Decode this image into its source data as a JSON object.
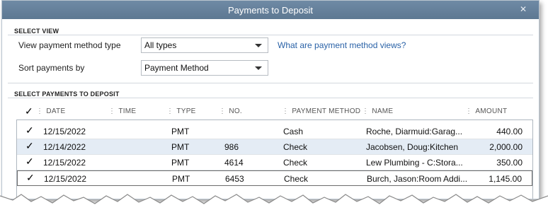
{
  "window": {
    "title": "Payments to Deposit",
    "close_glyph": "✕"
  },
  "select_view": {
    "header": "SELECT VIEW",
    "method_type_label": "View payment method type",
    "method_type_value": "All types",
    "help_link": "What are payment method views?",
    "sort_label": "Sort payments by",
    "sort_value": "Payment Method"
  },
  "payments": {
    "header": "SELECT PAYMENTS TO DEPOSIT",
    "check_glyph": "✓",
    "columns": [
      "DATE",
      "TIME",
      "TYPE",
      "NO.",
      "PAYMENT METHOD",
      "NAME",
      "AMOUNT"
    ],
    "rows": [
      {
        "checked": "✓",
        "date": "12/15/2022",
        "time": "",
        "type": "PMT",
        "no": "",
        "method": "Cash",
        "name": "Roche, Diarmuid:Garag...",
        "amount": "440.00"
      },
      {
        "checked": "✓",
        "date": "12/14/2022",
        "time": "",
        "type": "PMT",
        "no": "986",
        "method": "Check",
        "name": "Jacobsen, Doug:Kitchen",
        "amount": "2,000.00"
      },
      {
        "checked": "✓",
        "date": "12/15/2022",
        "time": "",
        "type": "PMT",
        "no": "4614",
        "method": "Check",
        "name": "Lew Plumbing - C:Stora...",
        "amount": "350.00"
      },
      {
        "checked": "✓",
        "date": "12/15/2022",
        "time": "",
        "type": "PMT",
        "no": "6453",
        "method": "Check",
        "name": "Burch, Jason:Room Addi...",
        "amount": "1,145.00"
      }
    ]
  },
  "colors": {
    "titlebar": "#6f8aa5",
    "link": "#2a62a7",
    "selected_row": "#e4ecf5"
  }
}
